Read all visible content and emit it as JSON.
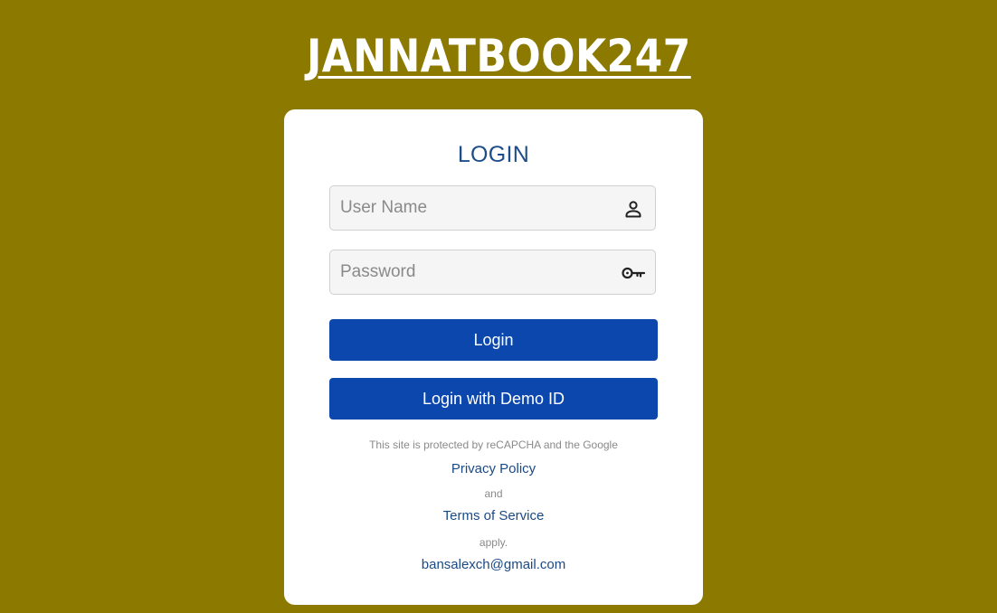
{
  "brand": {
    "title": "JANNATBOOK247"
  },
  "login_form": {
    "heading": "LOGIN",
    "username": {
      "placeholder": "User Name",
      "value": "",
      "icon": "user-icon"
    },
    "password": {
      "placeholder": "Password",
      "value": "",
      "icon": "key-icon"
    },
    "login_button": "Login",
    "demo_button": "Login with Demo ID"
  },
  "footer": {
    "recaptcha_text": "This site is protected by reCAPCHA and the Google",
    "privacy_link": "Privacy Policy",
    "and_text": "and",
    "terms_link": "Terms of Service",
    "apply_text": "apply.",
    "email": "bansalexch@gmail.com"
  },
  "colors": {
    "background": "#8c7900",
    "card": "#ffffff",
    "primary_button": "#0b47ad",
    "heading": "#1d4e8a",
    "link": "#1a4a86"
  }
}
